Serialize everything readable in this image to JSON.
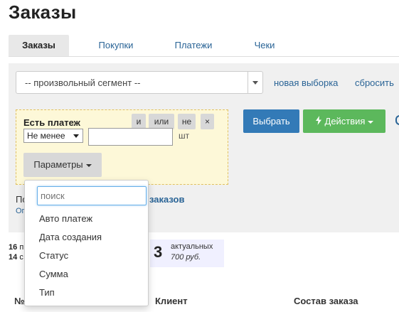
{
  "page": {
    "title": "Заказы"
  },
  "tabs": [
    {
      "label": "Заказы",
      "active": true
    },
    {
      "label": "Покупки",
      "active": false
    },
    {
      "label": "Платежи",
      "active": false
    },
    {
      "label": "Чеки",
      "active": false
    }
  ],
  "segment": {
    "selected": "-- произвольный сегмент --"
  },
  "links": {
    "new_selection": "новая выборка",
    "reset": "сбросить"
  },
  "filter": {
    "title": "Есть платеж",
    "logic_buttons": [
      "и",
      "или",
      "не",
      "×"
    ],
    "condition": "Не менее",
    "value": "",
    "unit": "шт",
    "params_label": "Параметры"
  },
  "actions": {
    "apply_label": "Выбрать",
    "actions_label": "Действия",
    "actions_icon": "bolt-icon"
  },
  "below": {
    "prefix": "По",
    "link_part": "заказов",
    "sub_prefix": "Ог"
  },
  "dropdown": {
    "search_placeholder": "поиск",
    "items": [
      "Авто платеж",
      "Дата создания",
      "Статус",
      "Сумма",
      "Тип"
    ]
  },
  "stats": {
    "line1_num": "16",
    "line1_text": "п",
    "line2_num": "14",
    "line2_text": "с",
    "card_count": "3",
    "card_label": "актуальных",
    "card_amount": "700 руб."
  },
  "table": {
    "headers": [
      "№",
      "Клиент",
      "Состав заказа"
    ]
  },
  "colors": {
    "primary": "#337ab7",
    "success": "#5cb85c",
    "link": "#2a6496",
    "filter_bg": "#fdf8d8"
  }
}
